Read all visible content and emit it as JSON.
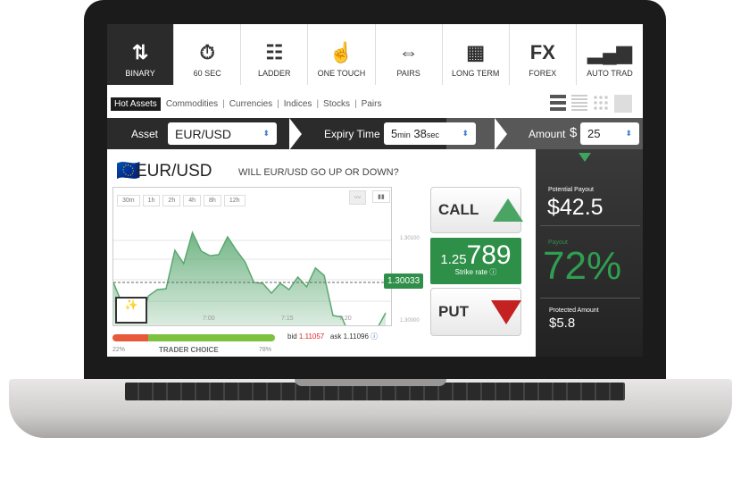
{
  "nav": [
    {
      "label": "BINARY",
      "icon": "up-down-arrows-icon",
      "glyph": "⇅"
    },
    {
      "label": "60 SEC",
      "icon": "stopwatch-icon",
      "glyph": "⏱"
    },
    {
      "label": "LADDER",
      "icon": "ladder-icon",
      "glyph": "☷"
    },
    {
      "label": "ONE TOUCH",
      "icon": "pointer-hand-icon",
      "glyph": "☝"
    },
    {
      "label": "PAIRS",
      "icon": "left-right-arrows-icon",
      "glyph": "⇔"
    },
    {
      "label": "LONG TERM",
      "icon": "calendar-icon",
      "glyph": "▦"
    },
    {
      "label": "FOREX",
      "icon": "fx-icon",
      "glyph": "FX"
    },
    {
      "label": "AUTO TRAD",
      "icon": "signal-bars-icon",
      "glyph": "▂▄▆"
    }
  ],
  "subnav": {
    "active": "Hot Assets",
    "items": [
      "Commodities",
      "Currencies",
      "Indices",
      "Stocks",
      "Pairs"
    ]
  },
  "trade_bar": {
    "asset_label": "Asset",
    "asset_value": "EUR/USD",
    "expiry_label": "Expiry Time",
    "expiry_min": "5",
    "expiry_min_unit": "min",
    "expiry_sec": "38",
    "expiry_sec_unit": "sec",
    "amount_label": "Amount",
    "currency": "$",
    "amount_value": "25"
  },
  "asset": {
    "title": "EUR/USD",
    "question": "WILL EUR/USD GO UP OR DOWN?"
  },
  "timeframes": [
    "30m",
    "1h",
    "2h",
    "4h",
    "8h",
    "12h"
  ],
  "chart": {
    "y_ticks": [
      "1.30100",
      "1.30000",
      "1.30000"
    ],
    "x_ticks": [
      "7:00",
      "7:15",
      "7:20"
    ],
    "current": "1.30033",
    "color": "#5aa870",
    "price_series": [
      1.29993,
      1.29939,
      1.29948,
      1.29893,
      1.29959,
      1.29975,
      1.29977,
      1.30075,
      1.30041,
      1.3012,
      1.30073,
      1.30061,
      1.30064,
      1.30109,
      1.30075,
      1.30045,
      1.29993,
      1.29991,
      1.29966,
      1.29991,
      1.29975,
      1.30007,
      1.29982,
      1.3003,
      1.30011,
      1.29909,
      1.29905,
      1.29852,
      1.29841,
      1.29857,
      1.29875,
      1.29916
    ]
  },
  "sentiment": {
    "put_pct": 22,
    "call_pct": 78,
    "put_label": "22%",
    "call_label": "78%",
    "title": "TRADER CHOICE",
    "bid_label": "bid",
    "bid": "1.11057",
    "ask_label": "ask",
    "ask": "1.11096"
  },
  "call": "CALL",
  "put": "PUT",
  "strike": {
    "prefix": "1.25",
    "main": "789",
    "label": "Strike rate"
  },
  "payout": {
    "potential_label": "Potential Payout",
    "potential": "$42.5",
    "payout_label": "Payout",
    "payout": "72%",
    "protected_label": "Protected Amount",
    "protected": "$5.8"
  }
}
